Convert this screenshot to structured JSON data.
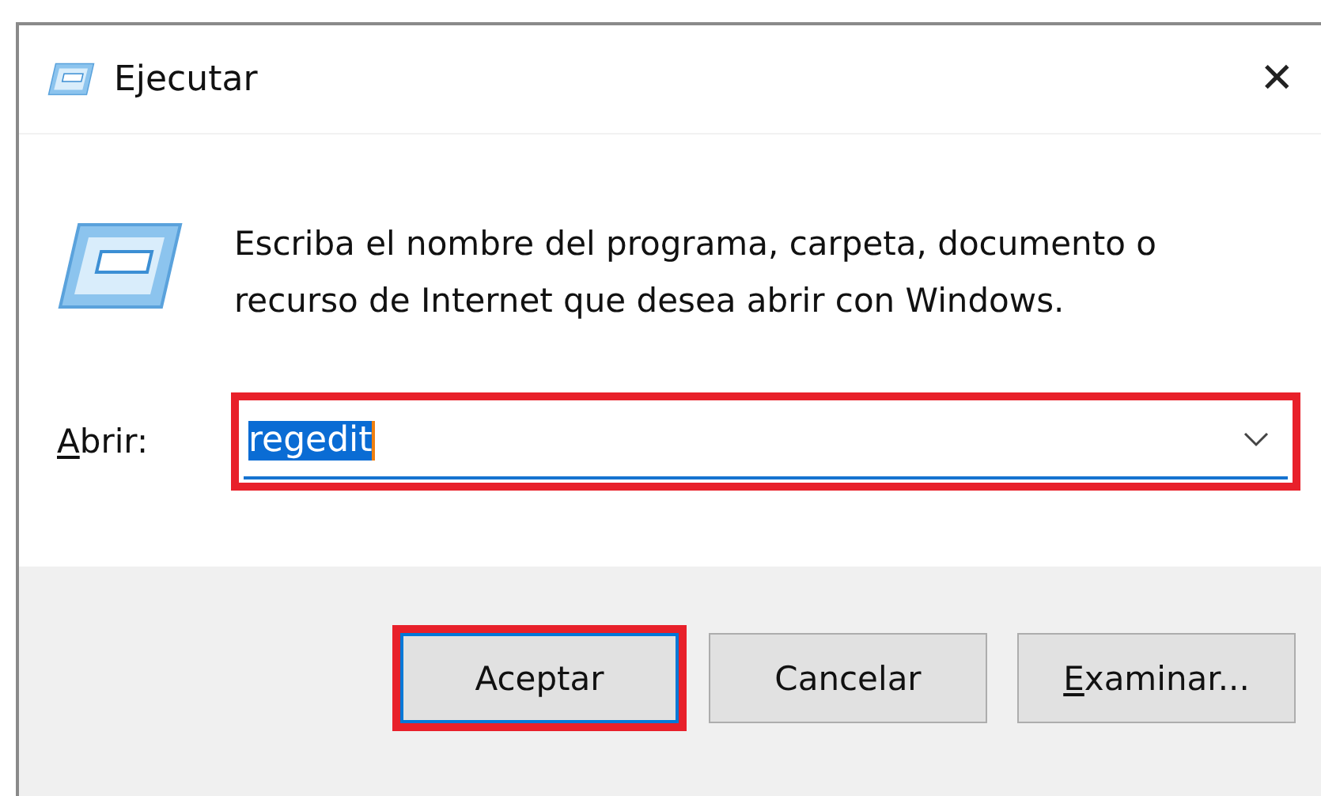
{
  "window": {
    "title": "Ejecutar",
    "close": "✕"
  },
  "message": "Escriba el nombre del programa, carpeta, documento o recurso de Internet que desea abrir con Windows.",
  "open_field": {
    "label": "Abrir:",
    "label_access_key": true,
    "value": "regedit",
    "value_selected": true,
    "highlighted": true
  },
  "buttons": [
    {
      "label": "Aceptar",
      "access_key": false,
      "highlighted": true,
      "focused": true
    },
    {
      "label": "Cancelar",
      "access_key": false,
      "highlighted": false,
      "focused": false
    },
    {
      "label": "Examinar...",
      "access_key": true,
      "highlighted": false,
      "focused": false
    }
  ]
}
